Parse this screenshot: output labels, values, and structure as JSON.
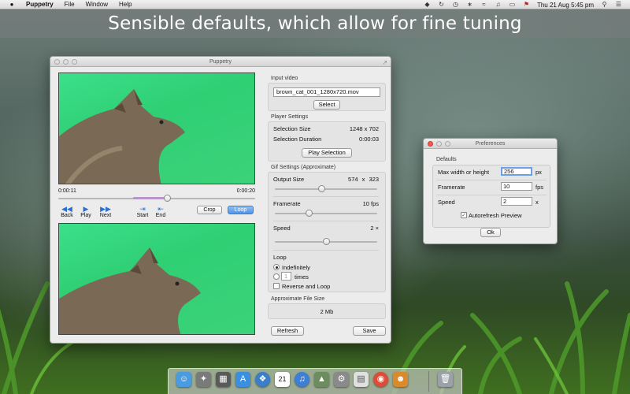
{
  "menubar": {
    "app_name": "Puppetry",
    "menus": [
      "File",
      "Window",
      "Help"
    ],
    "clock": "Thu 21 Aug  5:45 pm"
  },
  "banner": {
    "text": "Sensible defaults, which allow for fine tuning"
  },
  "main_window": {
    "title": "Puppetry",
    "timeline": {
      "current_time": "0:00:11",
      "total_time": "0:00:20",
      "position_fraction": 0.55,
      "selection_start_fraction": 0.38,
      "selection_end_fraction": 0.55
    },
    "transport": {
      "back": "Back",
      "play": "Play",
      "next": "Next",
      "start": "Start",
      "end": "End",
      "crop": "Crop",
      "loop": "Loop"
    },
    "input_video": {
      "label": "Input video",
      "file_name": "brown_cat_001_1280x720.mov",
      "select_button": "Select"
    },
    "player_settings": {
      "label": "Player Settings",
      "selection_size_label": "Selection Size",
      "selection_size_value": "1248 x 702",
      "selection_duration_label": "Selection Duration",
      "selection_duration_value": "0:00:03",
      "play_selection_button": "Play Selection"
    },
    "gif_settings": {
      "label": "Gif Settings (Approximate)",
      "output_size_label": "Output Size",
      "output_width": "574",
      "output_x": "x",
      "output_height": "323",
      "output_size_fraction": 0.45,
      "framerate_label": "Framerate",
      "framerate_value": "10 fps",
      "framerate_fraction": 0.33,
      "speed_label": "Speed",
      "speed_value": "2 ×",
      "speed_fraction": 0.5,
      "loop_label": "Loop",
      "loop_indefinitely": "Indefinitely",
      "loop_count": "1",
      "loop_times": "times",
      "reverse_and_loop": "Reverse and Loop"
    },
    "file_size": {
      "label": "Approximate File Size",
      "value": "2 Mb"
    },
    "refresh_button": "Refresh",
    "save_button": "Save"
  },
  "prefs_window": {
    "title": "Preferences",
    "defaults_label": "Defaults",
    "max_size_label": "Max width or height",
    "max_size_value": "256",
    "max_size_unit": "px",
    "framerate_label": "Framerate",
    "framerate_value": "10",
    "framerate_unit": "fps",
    "speed_label": "Speed",
    "speed_value": "2",
    "speed_unit": "x",
    "autorefresh_label": "Autorefresh Preview",
    "ok_button": "Ok"
  },
  "dock": {
    "icons": [
      "finder-icon",
      "launchpad-icon",
      "mission-control-icon",
      "app-store-icon",
      "safari-icon",
      "calendar-icon",
      "itunes-icon",
      "photos-icon",
      "system-preferences-icon",
      "preview-icon",
      "chrome-icon",
      "puppetry-icon",
      "trash-icon"
    ],
    "calendar_day": "21"
  },
  "colors": {
    "accent": "#4e94e8",
    "video_green": "#2fcf74",
    "close_red": "#ef5b51"
  }
}
